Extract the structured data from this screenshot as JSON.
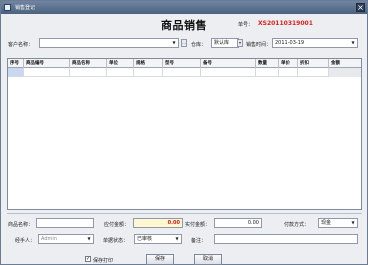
{
  "window": {
    "title": "销售登记",
    "close": "×"
  },
  "heading": "商品销售",
  "order": {
    "label": "单号：",
    "number": "XS20110319001"
  },
  "top_form": {
    "customer_label": "客户名称：",
    "customer_value": "",
    "warehouse_label": "仓库：",
    "warehouse_value": "默认库",
    "date_label": "销售时间：",
    "date_value": "2011-03-19"
  },
  "grid": {
    "columns": [
      "序号",
      "商品编号",
      "商品名称",
      "单位",
      "规格",
      "型号",
      "备号",
      "数量",
      "单价",
      "折扣",
      "金额"
    ],
    "rows": [
      [
        "",
        "",
        "",
        "",
        "",
        "",
        "",
        "",
        "",
        "",
        ""
      ]
    ]
  },
  "bottom_form": {
    "product_label": "商品名称：",
    "product_value": "",
    "payable_label": "应付金额：",
    "payable_value": "0.00",
    "paid_label": "实付金额：",
    "paid_value": "0.00",
    "payment_label": "付款方式：",
    "payment_value": "现金",
    "handler_label": "经手人：",
    "handler_value": "Admin",
    "status_label": "单据状态：",
    "status_value": "已审核",
    "remark_label": "备注：",
    "remark_value": ""
  },
  "footer": {
    "print_label": "保存打印",
    "print_checked": true,
    "save_label": "保存",
    "cancel_label": "取消"
  }
}
